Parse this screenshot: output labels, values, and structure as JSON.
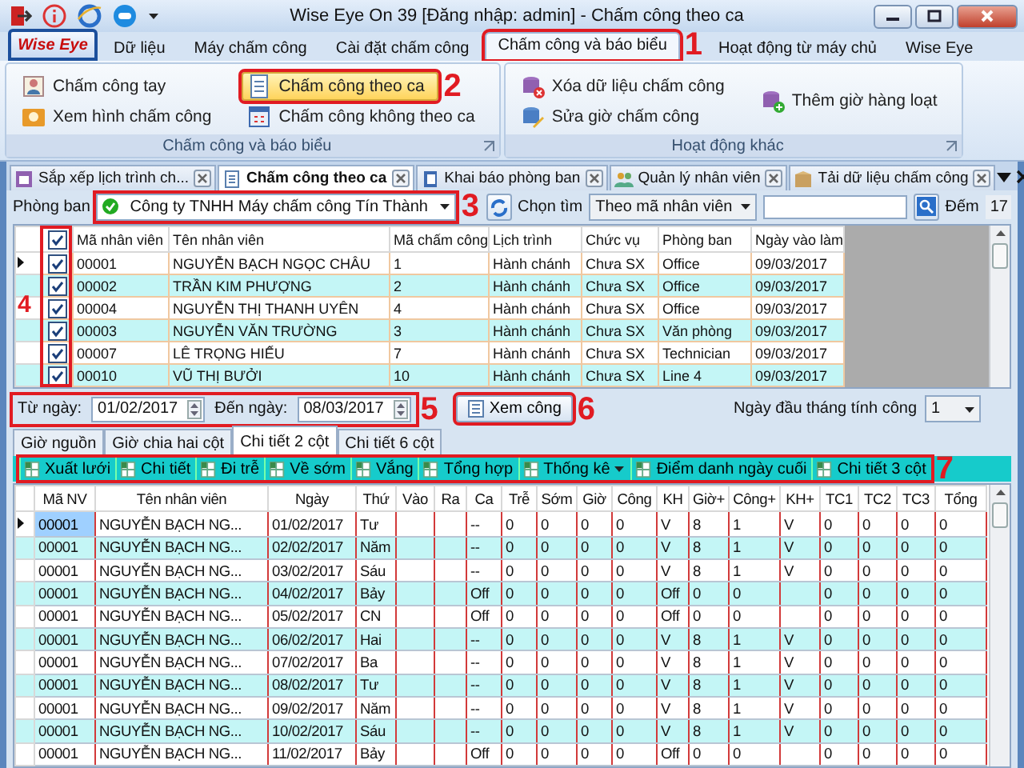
{
  "window": {
    "title": "Wise Eye On 39 [Đăng nhập: admin] - Chấm công theo ca"
  },
  "ribbon": {
    "app_button": "Wise Eye",
    "tabs": [
      {
        "label": "Dữ liệu",
        "selected": false
      },
      {
        "label": "Máy chấm công",
        "selected": false
      },
      {
        "label": "Cài đặt chấm công",
        "selected": false
      },
      {
        "label": "Chấm công và báo biểu",
        "selected": true,
        "callout": "1"
      },
      {
        "label": "Hoạt động từ máy chủ",
        "selected": false
      },
      {
        "label": "Wise Eye",
        "selected": false
      }
    ],
    "groups": [
      {
        "label": "Chấm công và báo biểu",
        "items": [
          {
            "label": "Chấm công tay",
            "selected": false
          },
          {
            "label": "Xem hình chấm công",
            "selected": false
          },
          {
            "label": "Chấm công theo ca",
            "selected": true,
            "callout": "2"
          },
          {
            "label": "Chấm công không theo ca",
            "selected": false
          }
        ]
      },
      {
        "label": "Hoạt động khác",
        "items": [
          {
            "label": "Xóa dữ liệu chấm công",
            "selected": false
          },
          {
            "label": "Sửa giờ chấm công",
            "selected": false
          },
          {
            "label": "Thêm giờ hàng loạt",
            "selected": false
          }
        ]
      }
    ]
  },
  "document_tabs": [
    {
      "label": "Sắp xếp lịch trình ch...",
      "selected": false
    },
    {
      "label": "Chấm công theo ca",
      "selected": true
    },
    {
      "label": "Khai báo phòng ban",
      "selected": false
    },
    {
      "label": "Quản lý nhân viên",
      "selected": false
    },
    {
      "label": "Tải dữ liệu chấm công",
      "selected": false
    }
  ],
  "filter": {
    "department_label": "Phòng ban",
    "department": "Công ty TNHH Máy chấm công Tín Thành",
    "department_callout": "3",
    "search_label": "Chọn tìm",
    "search_by": "Theo mã nhân viên",
    "count_label": "Đếm",
    "count": "17"
  },
  "employees": {
    "all_checked": true,
    "callout": "4",
    "columns": [
      "Mã nhân viên",
      "Tên nhân viên",
      "Mã chấm công",
      "Lịch trình",
      "Chức vụ",
      "Phòng ban",
      "Ngày vào làm"
    ],
    "rows": [
      {
        "current": true,
        "checked": true,
        "cells": [
          "00001",
          "NGUYỄN BẠCH NGỌC CHÂU",
          "1",
          "Hành chánh",
          "Chưa SX",
          "Office",
          "09/03/2017"
        ]
      },
      {
        "current": false,
        "checked": true,
        "cells": [
          "00002",
          "TRẦN KIM PHƯỢNG",
          "2",
          "Hành chánh",
          "Chưa SX",
          "Office",
          "09/03/2017"
        ]
      },
      {
        "current": false,
        "checked": true,
        "cells": [
          "00004",
          "NGUYỄN THỊ THANH UYÊN",
          "4",
          "Hành chánh",
          "Chưa SX",
          "Office",
          "09/03/2017"
        ]
      },
      {
        "current": false,
        "checked": true,
        "cells": [
          "00003",
          "NGUYỄN VĂN TRƯỜNG",
          "3",
          "Hành chánh",
          "Chưa SX",
          "Văn phòng",
          "09/03/2017"
        ]
      },
      {
        "current": false,
        "checked": true,
        "cells": [
          "00007",
          "LÊ TRỌNG HIẾU",
          "7",
          "Hành chánh",
          "Chưa SX",
          "Technician",
          "09/03/2017"
        ]
      },
      {
        "current": false,
        "checked": true,
        "cells": [
          "00010",
          "VŨ THỊ BƯỞI",
          "10",
          "Hành chánh",
          "Chưa SX",
          "Line 4",
          "09/03/2017"
        ]
      }
    ]
  },
  "date_range": {
    "from_label": "Từ ngày:",
    "from": "01/02/2017",
    "to_label": "Đến ngày:",
    "to": "08/03/2017",
    "callout": "5"
  },
  "view_button": {
    "label": "Xem công",
    "callout": "6"
  },
  "month_start": {
    "label": "Ngày đầu tháng tính công",
    "value": "1"
  },
  "view_tabs": [
    {
      "label": "Giờ nguồn",
      "selected": false
    },
    {
      "label": "Giờ chia hai cột",
      "selected": false
    },
    {
      "label": "Chi tiết 2 cột",
      "selected": true
    },
    {
      "label": "Chi tiết 6 cột",
      "selected": false
    }
  ],
  "toolbar": {
    "callout": "7",
    "buttons": [
      {
        "label": "Xuất lưới",
        "kind": "button"
      },
      {
        "label": "Chi tiết",
        "kind": "button"
      },
      {
        "label": "Đi trễ",
        "kind": "button"
      },
      {
        "label": "Về sớm",
        "kind": "button"
      },
      {
        "label": "Vắng",
        "kind": "button"
      },
      {
        "label": "Tổng hợp",
        "kind": "button"
      },
      {
        "label": "Thống kê",
        "kind": "dropdown"
      },
      {
        "label": "Điểm danh ngày cuối",
        "kind": "button"
      },
      {
        "label": "Chi tiết 3 cột",
        "kind": "button"
      }
    ]
  },
  "timesheet": {
    "columns": [
      "Mã NV",
      "Tên nhân viên",
      "Ngày",
      "Thứ",
      "Vào",
      "Ra",
      "Ca",
      "Trễ",
      "Sớm",
      "Giờ",
      "Công",
      "KH",
      "Giờ+",
      "Công+",
      "KH+",
      "TC1",
      "TC2",
      "TC3",
      "Tổng"
    ],
    "rows": [
      {
        "current": true,
        "cells": [
          "00001",
          "NGUYỄN BẠCH NG...",
          "01/02/2017",
          "Tư",
          null,
          null,
          "--",
          "0",
          "0",
          "0",
          "0",
          "V",
          "8",
          "1",
          "V",
          "0",
          "0",
          "0",
          "0"
        ]
      },
      {
        "current": false,
        "cells": [
          "00001",
          "NGUYỄN BẠCH NG...",
          "02/02/2017",
          "Năm",
          null,
          null,
          "--",
          "0",
          "0",
          "0",
          "0",
          "V",
          "8",
          "1",
          "V",
          "0",
          "0",
          "0",
          "0"
        ]
      },
      {
        "current": false,
        "cells": [
          "00001",
          "NGUYỄN BẠCH NG...",
          "03/02/2017",
          "Sáu",
          null,
          null,
          "--",
          "0",
          "0",
          "0",
          "0",
          "V",
          "8",
          "1",
          "V",
          "0",
          "0",
          "0",
          "0"
        ]
      },
      {
        "current": false,
        "cells": [
          "00001",
          "NGUYỄN BẠCH NG...",
          "04/02/2017",
          "Bảy",
          null,
          null,
          "Off",
          "0",
          "0",
          "0",
          "0",
          "Off",
          "0",
          "0",
          null,
          "0",
          "0",
          "0",
          "0"
        ]
      },
      {
        "current": false,
        "cells": [
          "00001",
          "NGUYỄN BẠCH NG...",
          "05/02/2017",
          "CN",
          null,
          null,
          "Off",
          "0",
          "0",
          "0",
          "0",
          "Off",
          "0",
          "0",
          null,
          "0",
          "0",
          "0",
          "0"
        ]
      },
      {
        "current": false,
        "cells": [
          "00001",
          "NGUYỄN BẠCH NG...",
          "06/02/2017",
          "Hai",
          null,
          null,
          "--",
          "0",
          "0",
          "0",
          "0",
          "V",
          "8",
          "1",
          "V",
          "0",
          "0",
          "0",
          "0"
        ]
      },
      {
        "current": false,
        "cells": [
          "00001",
          "NGUYỄN BẠCH NG...",
          "07/02/2017",
          "Ba",
          null,
          null,
          "--",
          "0",
          "0",
          "0",
          "0",
          "V",
          "8",
          "1",
          "V",
          "0",
          "0",
          "0",
          "0"
        ]
      },
      {
        "current": false,
        "cells": [
          "00001",
          "NGUYỄN BẠCH NG...",
          "08/02/2017",
          "Tư",
          null,
          null,
          "--",
          "0",
          "0",
          "0",
          "0",
          "V",
          "8",
          "1",
          "V",
          "0",
          "0",
          "0",
          "0"
        ]
      },
      {
        "current": false,
        "cells": [
          "00001",
          "NGUYỄN BẠCH NG...",
          "09/02/2017",
          "Năm",
          null,
          null,
          "--",
          "0",
          "0",
          "0",
          "0",
          "V",
          "8",
          "1",
          "V",
          "0",
          "0",
          "0",
          "0"
        ]
      },
      {
        "current": false,
        "cells": [
          "00001",
          "NGUYỄN BẠCH NG...",
          "10/02/2017",
          "Sáu",
          null,
          null,
          "--",
          "0",
          "0",
          "0",
          "0",
          "V",
          "8",
          "1",
          "V",
          "0",
          "0",
          "0",
          "0"
        ]
      },
      {
        "current": false,
        "cells": [
          "00001",
          "NGUYỄN BẠCH NG...",
          "11/02/2017",
          "Bảy",
          null,
          null,
          "Off",
          "0",
          "0",
          "0",
          "0",
          "Off",
          "0",
          "0",
          null,
          "0",
          "0",
          "0",
          "0"
        ]
      }
    ]
  }
}
